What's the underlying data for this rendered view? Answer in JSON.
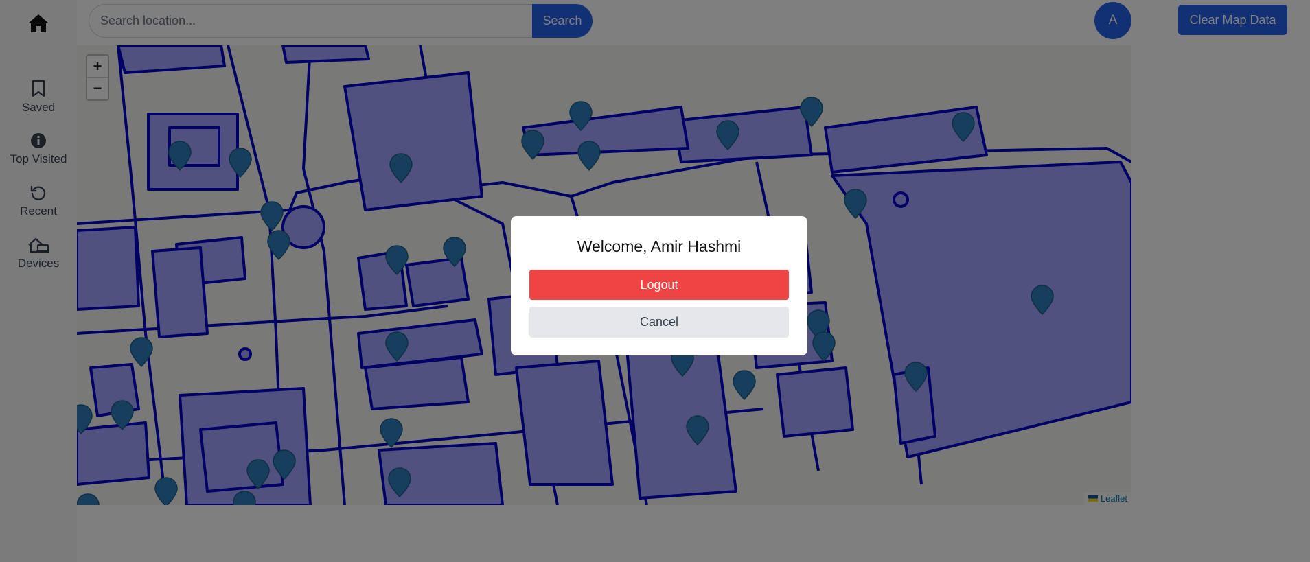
{
  "search": {
    "placeholder": "Search location...",
    "value": "",
    "button_label": "Search"
  },
  "sidebar": {
    "items": [
      {
        "label": "Saved",
        "icon": "bookmark-icon"
      },
      {
        "label": "Top Visited",
        "icon": "info-icon"
      },
      {
        "label": "Recent",
        "icon": "history-icon"
      },
      {
        "label": "Devices",
        "icon": "devices-icon"
      }
    ]
  },
  "header": {
    "avatar_initial": "A",
    "clear_map_label": "Clear Map Data"
  },
  "map": {
    "zoom_in": "+",
    "zoom_out": "−",
    "attribution": "Leaflet",
    "marker_count": 34,
    "colors": {
      "building_fill": "#a3a3ff",
      "outline": "#0000cc",
      "marker": "#2b7fb8"
    }
  },
  "modal": {
    "title": "Welcome, Amir Hashmi",
    "logout_label": "Logout",
    "cancel_label": "Cancel"
  },
  "colors": {
    "primary": "#2563eb",
    "danger": "#ef4444",
    "overlay": "rgba(0,0,0,0.5)"
  }
}
